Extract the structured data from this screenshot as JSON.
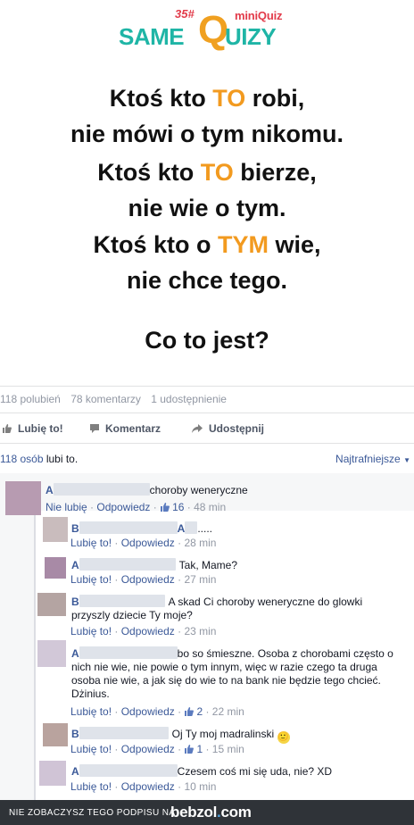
{
  "quiz": {
    "logo": {
      "number": "35#",
      "mini": "miniQuiz",
      "same": "SAME",
      "q": "Q",
      "uizy": "UIZY"
    },
    "line1a": "Ktoś kto ",
    "line1hl": "TO",
    "line1b": " robi,",
    "line2": "nie mówi o tym nikomu.",
    "line3a": "Ktoś kto ",
    "line3hl": "TO",
    "line3b": " bierze,",
    "line4": "nie wie o tym.",
    "line5a": "Ktoś kto o ",
    "line5hl": "TYM",
    "line5b": " wie,",
    "line6": "nie chce tego.",
    "question": "Co to jest?",
    "highlight_color": "#f29a1f"
  },
  "stats": {
    "likes": "118 polubień",
    "comments": "78 komentarzy",
    "shares": "1 udostępnienie"
  },
  "actions": {
    "like": "Lubię to!",
    "comment": "Komentarz",
    "share": "Udostępnij"
  },
  "likes_row": {
    "count": "118 osób",
    "text": " lubi to.",
    "sort": "Najtrafniejsze"
  },
  "comments": [
    {
      "initial": "A",
      "text": "choroby weneryczne",
      "action": "Nie lubię",
      "reply": "Odpowiedz",
      "likes": "16",
      "time": "48 min"
    },
    {
      "initial": "B",
      "mention_initial": "A",
      "text": ".....",
      "action": "Lubię to!",
      "reply": "Odpowiedz",
      "time": "28 min"
    },
    {
      "initial": "A",
      "text": "Tak, Mame?",
      "action": "Lubię to!",
      "reply": "Odpowiedz",
      "time": "27 min"
    },
    {
      "initial": "B",
      "text_line1": "A skad Ci choroby weneryczne do glowki",
      "text_line2": "przyszly dziecie Ty moje?",
      "action": "Lubię to!",
      "reply": "Odpowiedz",
      "time": "23 min"
    },
    {
      "initial": "A",
      "text_line1": "bo so śmieszne. Osoba z chorobami często o",
      "text_line2": "nich nie wie, nie powie o tym innym, więc w razie czego ta druga",
      "text_line3": "osoba nie wie, a jak się do wie to na bank nie będzie tego chcieć.",
      "text_line4": "Dżinius.",
      "action": "Lubię to!",
      "reply": "Odpowiedz",
      "likes": "2",
      "time": "22 min"
    },
    {
      "initial": "B",
      "text": "Oj Ty moj madralinski",
      "emoji": "🙂",
      "action": "Lubię to!",
      "reply": "Odpowiedz",
      "likes": "1",
      "time": "15 min"
    },
    {
      "initial": "A",
      "text": "Czesem coś mi się uda, nie? XD",
      "action": "Lubię to!",
      "reply": "Odpowiedz",
      "time": "10 min"
    }
  ],
  "footer": {
    "text": "NIE ZOBACZYSZ TEGO PODPISU NA",
    "logo_a": "bebzol",
    "logo_dot": ".",
    "logo_b": "com"
  },
  "colors": {
    "link": "#3b5998",
    "meta": "#9197a3",
    "accent": "#f29a1f",
    "logo_teal": "#1fb5a6",
    "footer_bg": "#2f3338"
  }
}
